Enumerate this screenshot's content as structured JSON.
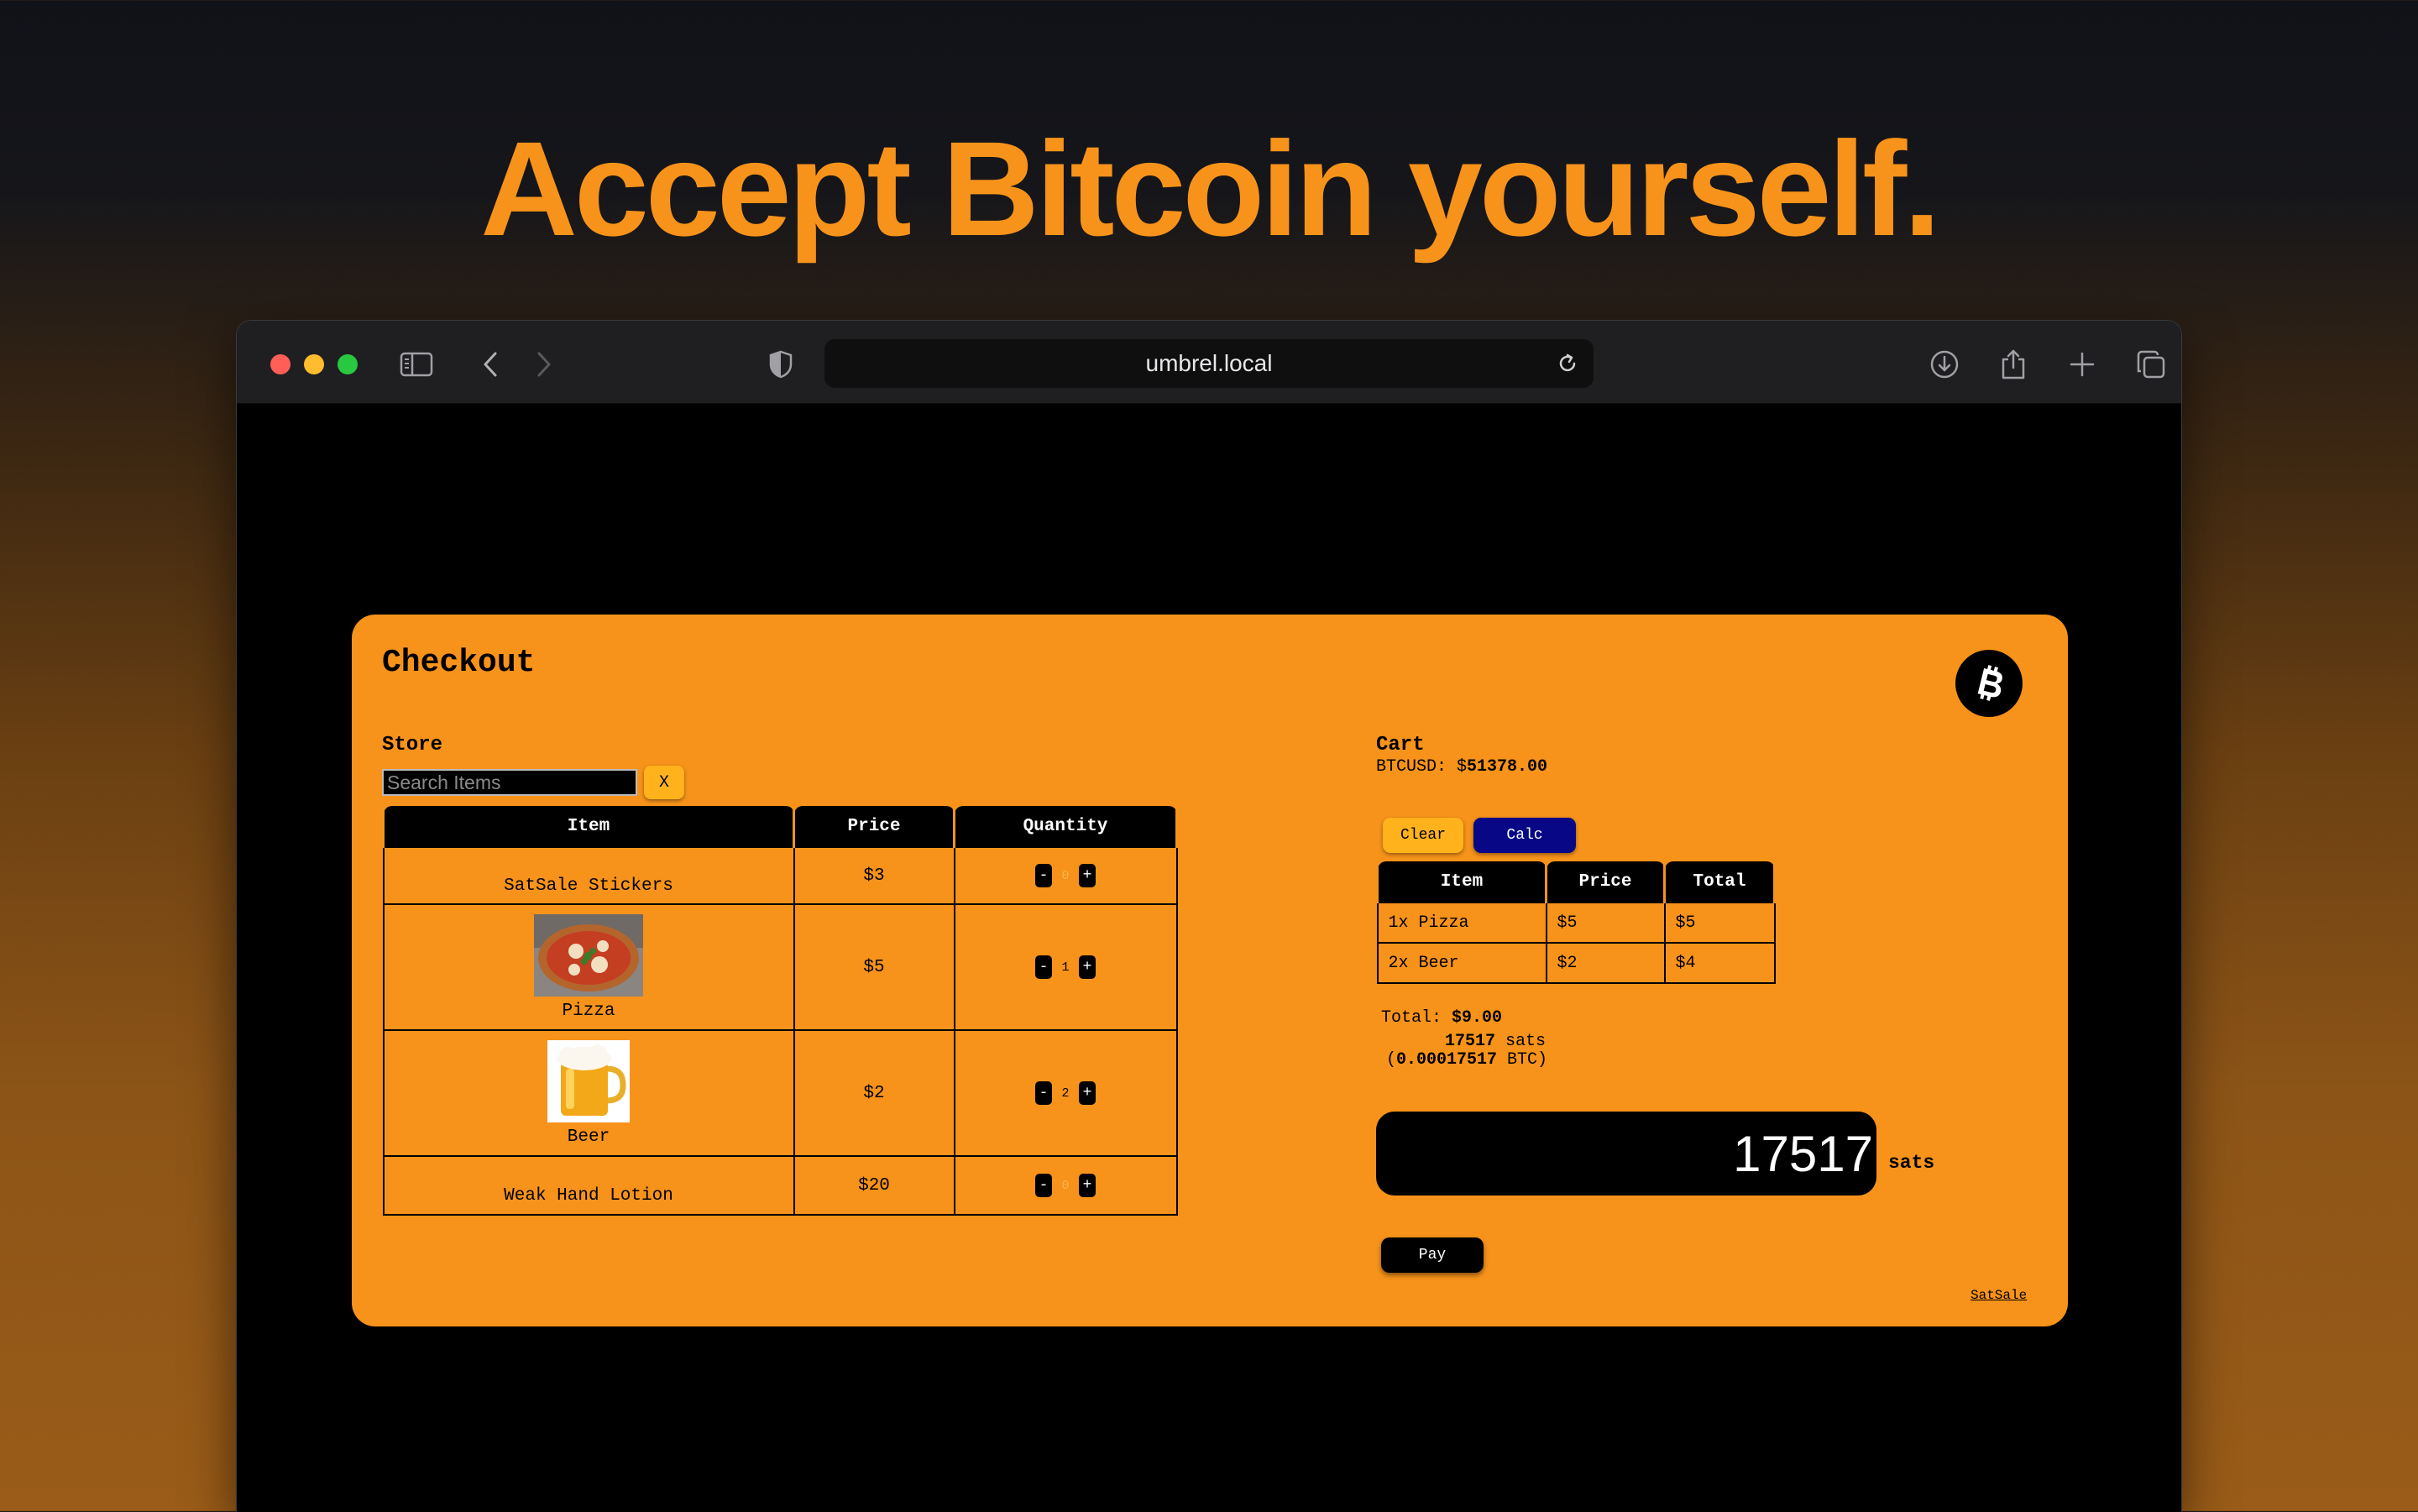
{
  "headline": "Accept Bitcoin yourself.",
  "browser": {
    "url": "umbrel.local",
    "icons": [
      "sidebar-icon",
      "back-icon",
      "forward-icon",
      "shield-icon",
      "reload-icon",
      "download-icon",
      "share-icon",
      "new-tab-icon",
      "tabs-icon"
    ]
  },
  "checkout": {
    "title": "Checkout",
    "store": {
      "label": "Store",
      "search_placeholder": "Search Items",
      "clear_search_label": "X",
      "columns": [
        "Item",
        "Price",
        "Quantity"
      ],
      "items": [
        {
          "name": "SatSale Stickers",
          "price": "$3",
          "quantity": "0",
          "image": ""
        },
        {
          "name": "Pizza",
          "price": "$5",
          "quantity": "1",
          "image": "pizza"
        },
        {
          "name": "Beer",
          "price": "$2",
          "quantity": "2",
          "image": "beer"
        },
        {
          "name": "Weak Hand Lotion",
          "price": "$20",
          "quantity": "0",
          "image": ""
        }
      ],
      "minus_label": "-",
      "plus_label": "+"
    },
    "cart": {
      "label": "Cart",
      "rate_label": "BTCUSD: $",
      "rate_value": "51378.00",
      "clear_label": "Clear",
      "calc_label": "Calc",
      "columns": [
        "Item",
        "Price",
        "Total"
      ],
      "rows": [
        {
          "item": "1x Pizza",
          "price": "$5",
          "total": "$5"
        },
        {
          "item": "2x Beer",
          "price": "$2",
          "total": "$4"
        }
      ],
      "total_label": "Total: ",
      "total_value": "$9.00",
      "sats_value": "17517",
      "sats_word": " sats",
      "btc_open": "(",
      "btc_value": "0.00017517",
      "btc_close": " BTC)",
      "amount_display": "17517",
      "amount_unit": "sats",
      "pay_label": "Pay"
    },
    "footer_link": "SatSale",
    "colors": {
      "accent": "#f7931a",
      "calc": "#080886",
      "clear": "#ffb21c"
    }
  }
}
